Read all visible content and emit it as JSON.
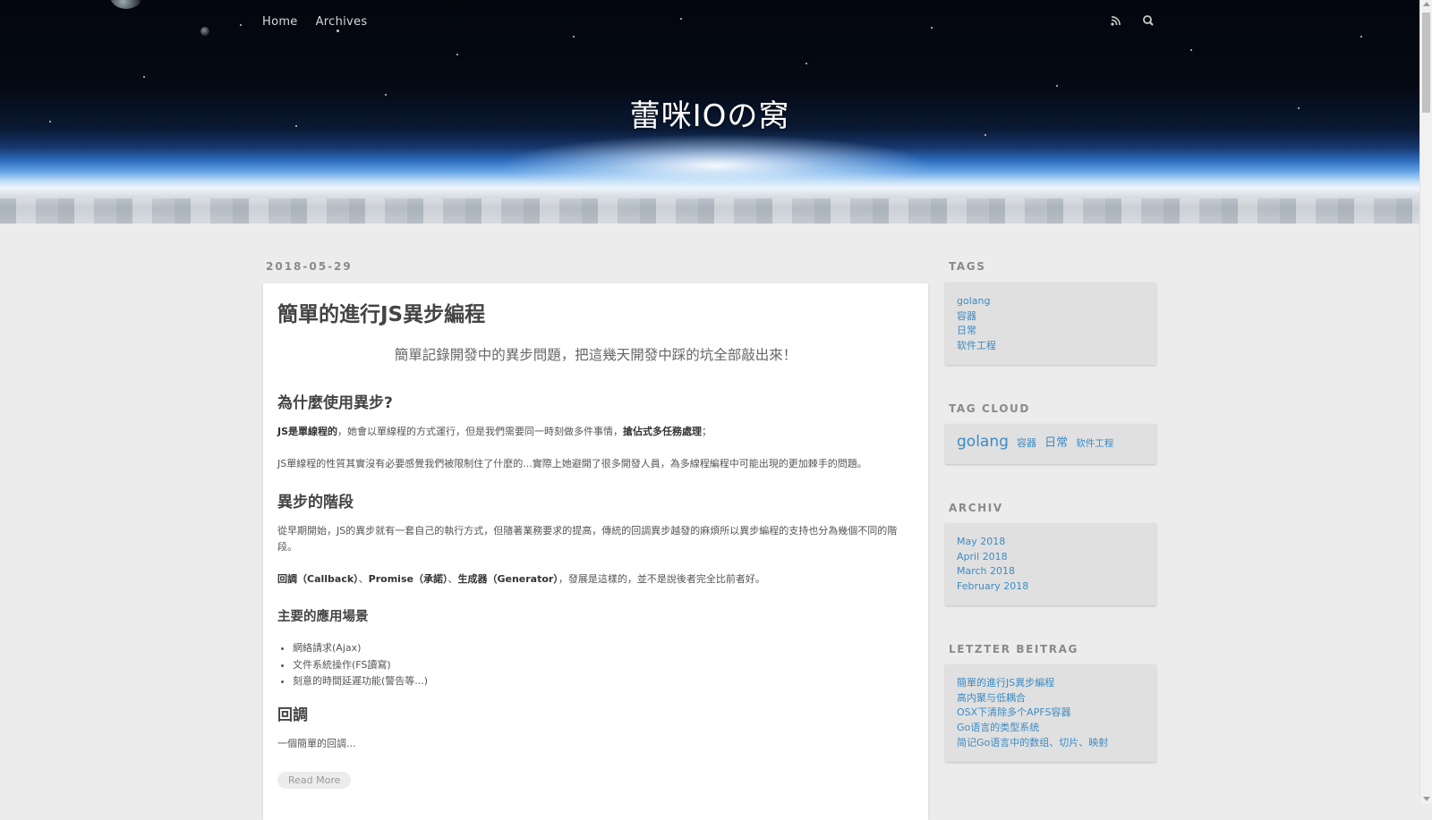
{
  "header": {
    "nav": [
      {
        "label": "Home"
      },
      {
        "label": "Archives"
      }
    ],
    "icons": [
      "rss-icon",
      "search-icon"
    ],
    "site_title": "蕾咪IOの窝"
  },
  "post": {
    "date": "2018-05-29",
    "title": "簡單的進行JS異步編程",
    "quote": "簡單記錄開發中的異步問題，把這幾天開發中踩的坑全部敲出來！",
    "section1_heading": "為什麼使用異步?",
    "p1_bold1": "JS是單線程的",
    "p1_text": "，她會以單線程的方式運行，但是我們需要同一時刻做多件事情，",
    "p1_bold2": "搶佔式多任務處理",
    "p1_end": "；",
    "p2": "JS單線程的性質其實沒有必要感覺我們被限制住了什麼的...實際上她避開了很多開發人員，為多線程編程中可能出現的更加棘手的問題。",
    "section2_heading": "異步的階段",
    "p3": "從早期開始，JS的異步就有一套自己的執行方式，但隨著業務要求的提高，傳統的回調異步越發的麻煩所以異步編程的支持也分為幾個不同的階段。",
    "p4_b1": "回調（Callback）",
    "p4_s1": "、",
    "p4_b2": "Promise（承諾）",
    "p4_s2": "、",
    "p4_b3": "生成器（Generator）",
    "p4_end": "，發展是這樣的，並不是說後者完全比前者好。",
    "section3_heading": "主要的應用場景",
    "bullets": [
      "網絡請求(Ajax)",
      "文件系統操作(FS讀寫)",
      "刻意的時間延遲功能(警告等...)"
    ],
    "section4_heading": "回調",
    "p5": "一個簡單的回調...",
    "read_more": "Read More"
  },
  "sidebar": {
    "tags_title": "TAGS",
    "tags": [
      "golang",
      "容器",
      "日常",
      "软件工程"
    ],
    "cloud_title": "TAG CLOUD",
    "cloud": [
      "golang",
      "容器",
      "日常",
      "软件工程"
    ],
    "archive_title": "ARCHIV",
    "archive": [
      "May 2018",
      "April 2018",
      "March 2018",
      "February 2018"
    ],
    "recent_title": "LETZTER BEITRAG",
    "recent": [
      "簡單的進行JS異步編程",
      "高内聚与低耦合",
      "OSX下清除多个APFS容器",
      "Go语言的类型系统",
      "简记Go语言中的数组、切片、映射"
    ]
  },
  "colors": {
    "link": "#3c8bc4",
    "page_bg": "#ececec",
    "card_bg": "#ffffff",
    "sidebar_box_bg": "#e0e0e0"
  }
}
